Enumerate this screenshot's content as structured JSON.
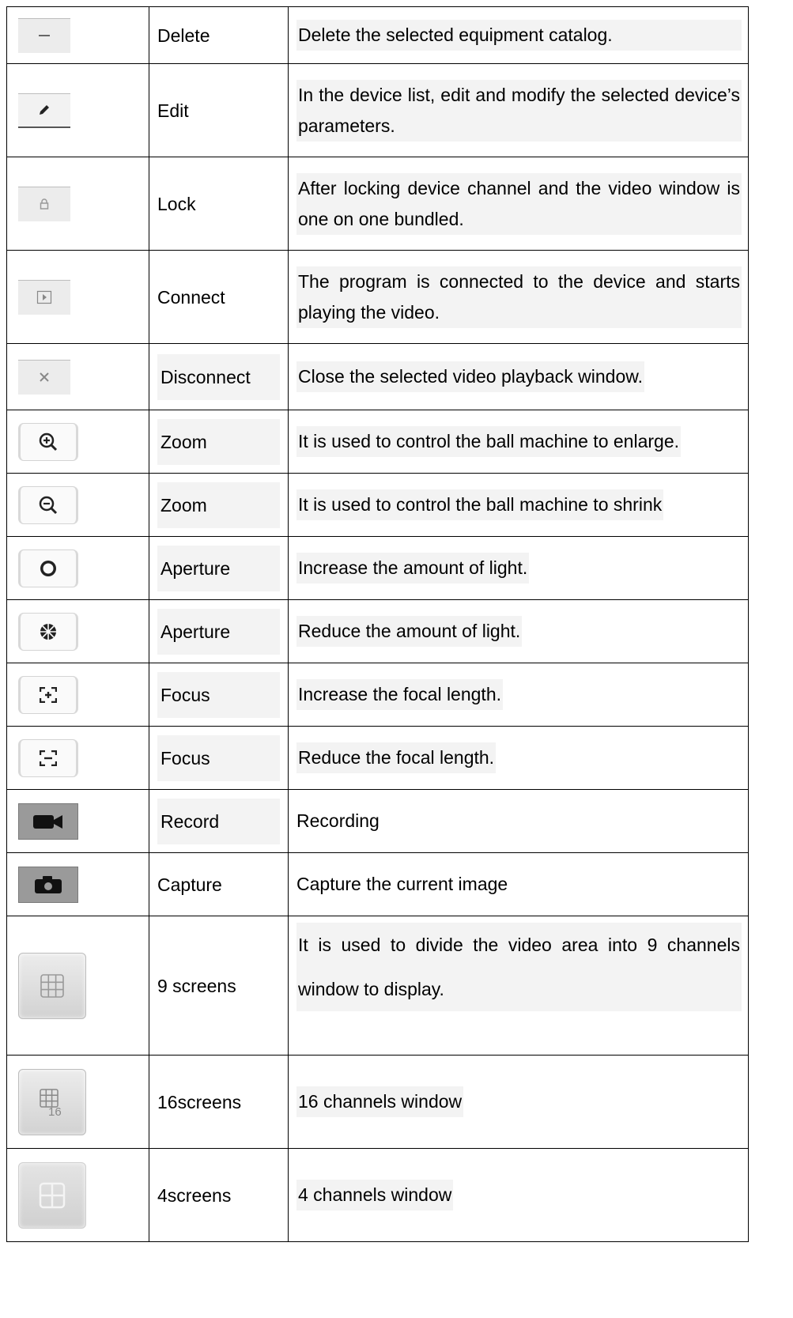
{
  "rows": [
    {
      "icon": "minus-icon",
      "name": "Delete",
      "desc": "Delete the selected equipment catalog."
    },
    {
      "icon": "pencil-icon",
      "name": "Edit",
      "desc": "In the device list, edit and modify the selected device’s parameters."
    },
    {
      "icon": "lock-icon",
      "name": "Lock",
      "desc": "After locking device channel and the video window is one on one bundled."
    },
    {
      "icon": "play-icon",
      "name": "Connect",
      "desc": "The program is connected to the device and starts playing the video."
    },
    {
      "icon": "close-icon",
      "name": "Disconnect",
      "desc": "Close the selected video playback window."
    },
    {
      "icon": "zoom-in-icon",
      "name": "Zoom",
      "desc": "It is used to control the ball machine to enlarge."
    },
    {
      "icon": "zoom-out-icon",
      "name": "Zoom",
      "desc": "It is used to control the ball machine to shrink"
    },
    {
      "icon": "aperture-open-icon",
      "name": "Aperture",
      "desc": "Increase the amount of light."
    },
    {
      "icon": "aperture-closed-icon",
      "name": "Aperture",
      "desc": "Reduce the amount of light."
    },
    {
      "icon": "focus-plus-icon",
      "name": "Focus",
      "desc": "Increase the focal length."
    },
    {
      "icon": "focus-minus-icon",
      "name": "Focus",
      "desc": "Reduce the focal length."
    },
    {
      "icon": "video-camera-icon",
      "name": "Record",
      "desc": "Recording"
    },
    {
      "icon": "camera-icon",
      "name": "Capture",
      "desc": "Capture the current image"
    },
    {
      "icon": "grid-9-icon",
      "name": "9 screens",
      "desc": "It is used to divide the video area into 9 channels window to display."
    },
    {
      "icon": "grid-16-icon",
      "name": "16screens",
      "desc": "16 channels window",
      "icon_text": "16"
    },
    {
      "icon": "grid-4-icon",
      "name": "4screens",
      "desc": "4 channels window"
    }
  ]
}
